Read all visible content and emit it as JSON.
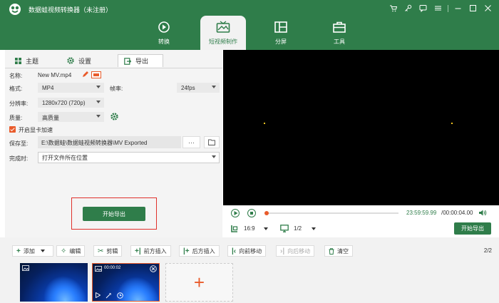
{
  "app": {
    "title": "数据蛙视频转换器（未注册）",
    "window_icons": [
      "cart-icon",
      "key-icon",
      "chat-icon",
      "menu-icon",
      "minimize-icon",
      "maximize-icon",
      "close-icon"
    ]
  },
  "nav": [
    {
      "label": "转换",
      "icon": "convert-icon"
    },
    {
      "label": "短视频制作",
      "icon": "mv-icon",
      "active": true
    },
    {
      "label": "分屏",
      "icon": "split-icon"
    },
    {
      "label": "工具",
      "icon": "toolbox-icon"
    }
  ],
  "tabs": {
    "theme": "主题",
    "settings": "设置",
    "export": "导出"
  },
  "form": {
    "name_label": "名称:",
    "name_value": "New MV.mp4",
    "format_label": "格式:",
    "format_value": "MP4",
    "fps_label": "帧率:",
    "fps_value": "24fps",
    "resolution_label": "分辨率:",
    "resolution_value": "1280x720 (720p)",
    "quality_label": "质量:",
    "quality_value": "高质量",
    "gpu_label": "开启显卡加速",
    "saveto_label": "保存至:",
    "saveto_value": "E:\\数据蛙\\数据蛙视频转换器\\MV Exported",
    "more_label": "···",
    "complete_label": "完成时:",
    "complete_value": "打开文件所在位置",
    "export_button": "开始导出"
  },
  "player": {
    "time_current": "23:59:59.99",
    "time_total": "/00:00:04.00",
    "aspect": "16:9",
    "page": "1/2",
    "export_button": "开始导出",
    "progress": 0
  },
  "toolbar": {
    "add": "添加",
    "edit": "编辑",
    "cut": "剪辑",
    "insert_before": "前方插入",
    "insert_after": "后方插入",
    "move_forward": "向前移动",
    "move_backward": "向后移动",
    "clear": "清空",
    "count": "2/2"
  },
  "clips": [
    {
      "duration": "",
      "selected": false
    },
    {
      "duration": "00:00:02",
      "selected": true
    }
  ],
  "colors": {
    "brand": "#2f7d4a",
    "accent": "#e95b2b",
    "highlight": "#e0302b"
  }
}
